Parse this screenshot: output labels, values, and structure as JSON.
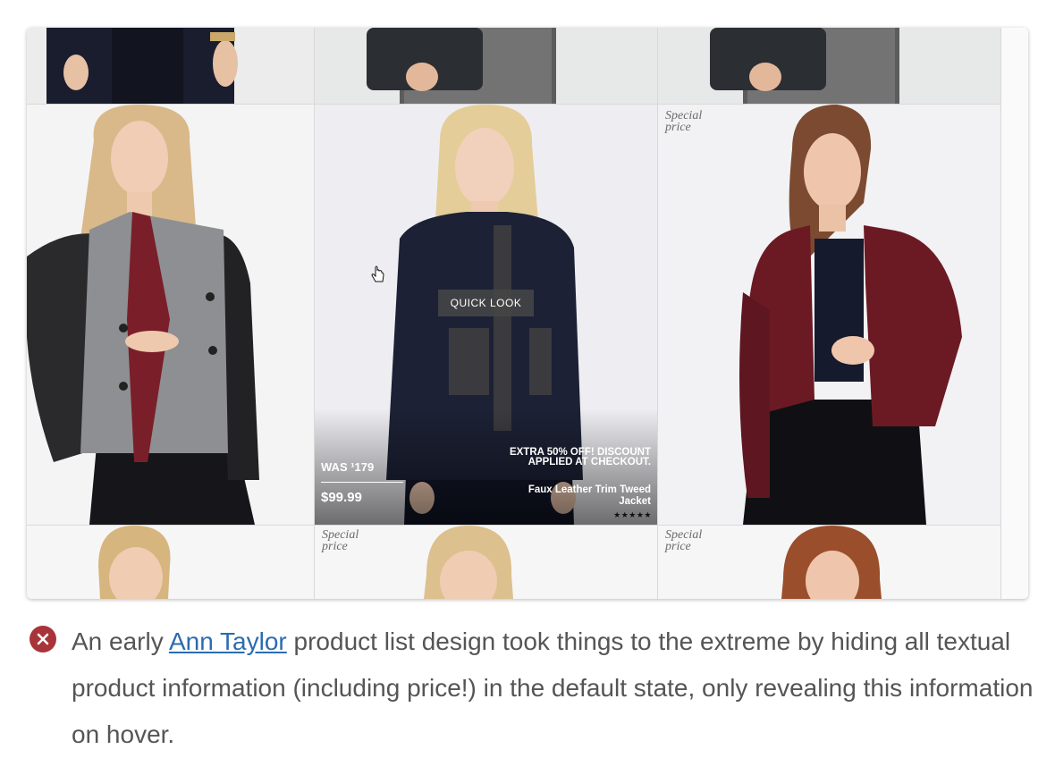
{
  "gallery": {
    "special_price_label": "Special\nprice",
    "hover_item": {
      "quick_look_label": "QUICK LOOK",
      "was_price": "WAS ¹179",
      "current_price": "$99.99",
      "promo_text": "EXTRA 50% OFF! DISCOUNT APPLIED AT CHECKOUT.",
      "product_name": "Faux Leather Trim Tweed Jacket",
      "rating_stars": "★★★★★"
    }
  },
  "caption": {
    "before_link": "An early ",
    "link_text": "Ann Taylor",
    "after_link": " product list design took things to the extreme by hiding all textual product information (including price!) in the default state, only revealing this information on hover."
  },
  "colors": {
    "error_icon": "#a8343a",
    "link": "#2b6cb0",
    "caption_text": "#555555"
  },
  "icons": {
    "status": "close-circle-icon",
    "cursor": "hand-cursor-icon"
  }
}
